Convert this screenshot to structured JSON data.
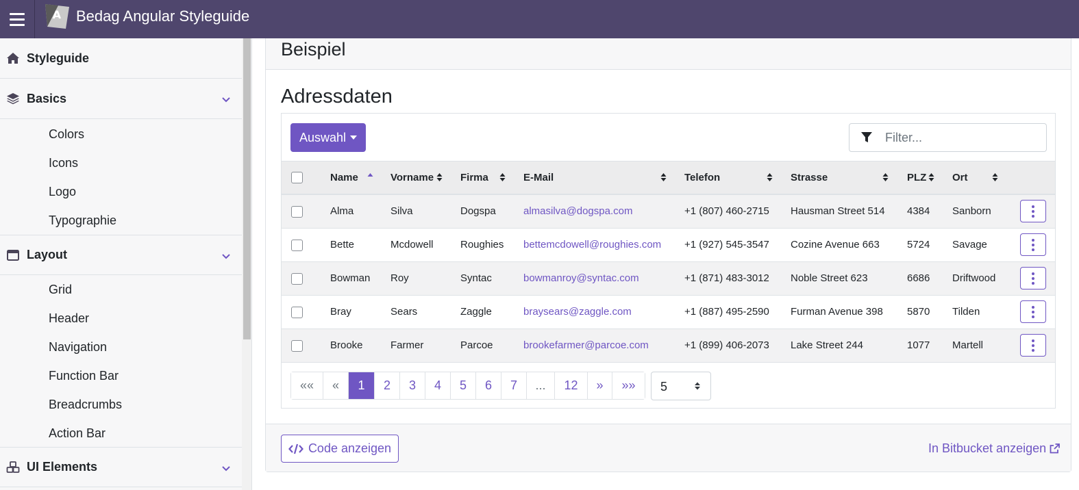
{
  "app": {
    "title": "Bedag Angular Styleguide",
    "logo_letter": "A"
  },
  "sidebar": {
    "sections": [
      {
        "label": "Styleguide",
        "icon": "home-icon"
      },
      {
        "label": "Basics",
        "icon": "layers-icon",
        "items": [
          "Colors",
          "Icons",
          "Logo",
          "Typographie"
        ]
      },
      {
        "label": "Layout",
        "icon": "window-icon",
        "items": [
          "Grid",
          "Header",
          "Navigation",
          "Function Bar",
          "Breadcrumbs",
          "Action Bar"
        ]
      },
      {
        "label": "UI Elements",
        "icon": "cubes-icon"
      }
    ]
  },
  "card": {
    "header_title": "Beispiel",
    "subtitle": "Adressdaten",
    "select_button": "Auswahl",
    "filter_placeholder": "Filter...",
    "footer": {
      "code_button": "Code anzeigen",
      "bitbucket_link": "In Bitbucket anzeigen"
    }
  },
  "table": {
    "columns": [
      "Name",
      "Vorname",
      "Firma",
      "E-Mail",
      "Telefon",
      "Strasse",
      "PLZ",
      "Ort"
    ],
    "sorted_column": "Name",
    "rows": [
      [
        "Alma",
        "Silva",
        "Dogspa",
        "almasilva@dogspa.com",
        "+1 (807) 460-2715",
        "Hausman Street 514",
        "4384",
        "Sanborn"
      ],
      [
        "Bette",
        "Mcdowell",
        "Roughies",
        "bettemcdowell@roughies.com",
        "+1 (927) 545-3547",
        "Cozine Avenue 663",
        "5724",
        "Savage"
      ],
      [
        "Bowman",
        "Roy",
        "Syntac",
        "bowmanroy@syntac.com",
        "+1 (871) 483-3012",
        "Noble Street 623",
        "6686",
        "Driftwood"
      ],
      [
        "Bray",
        "Sears",
        "Zaggle",
        "braysears@zaggle.com",
        "+1 (887) 495-2590",
        "Furman Avenue 398",
        "5870",
        "Tilden"
      ],
      [
        "Brooke",
        "Farmer",
        "Parcoe",
        "brookefarmer@parcoe.com",
        "+1 (899) 406-2073",
        "Lake Street 244",
        "1077",
        "Martell"
      ]
    ]
  },
  "pagination": {
    "first": "««",
    "prev": "«",
    "pages": [
      "1",
      "2",
      "3",
      "4",
      "5",
      "6",
      "7",
      "...",
      "12"
    ],
    "active_page": "1",
    "next": "»",
    "last": "»»",
    "page_size": "5"
  },
  "colors": {
    "topbar": "#4f466d",
    "accent": "#6f56c3",
    "sidebar_bg": "#f7f7f8"
  }
}
